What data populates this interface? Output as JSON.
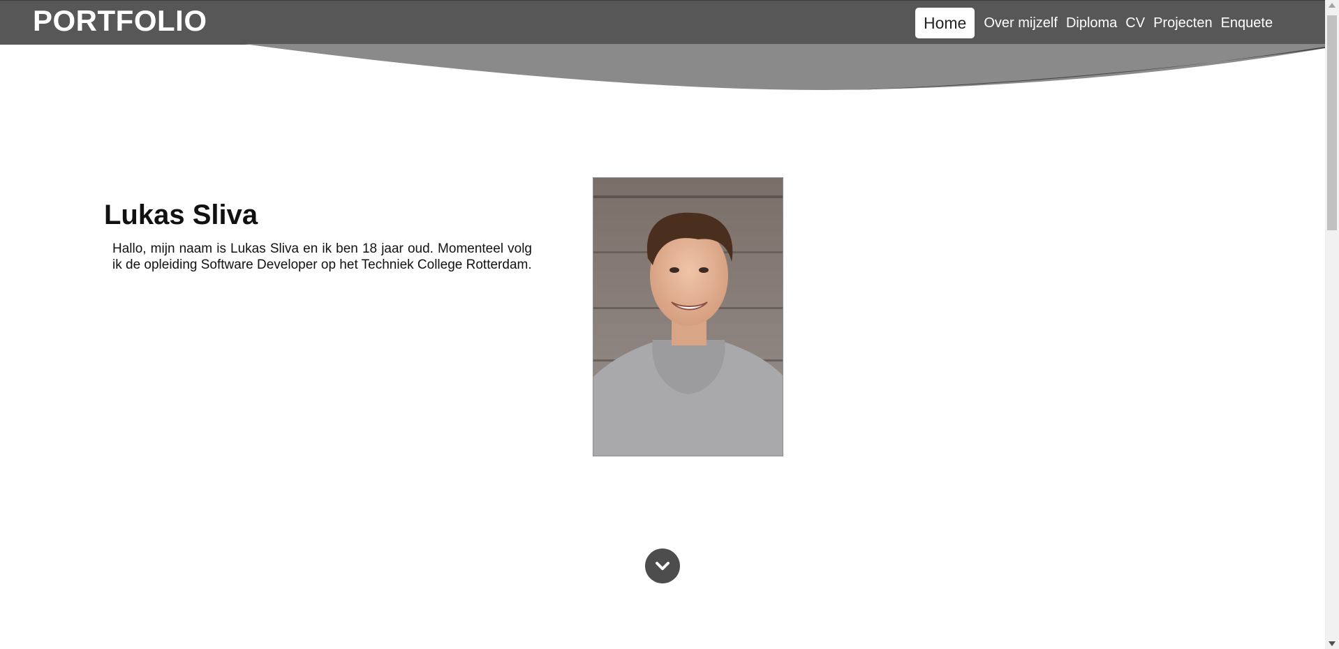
{
  "header": {
    "brand": "PORTFOLIO",
    "nav": [
      {
        "label": "Home",
        "active": true
      },
      {
        "label": "Over mijzelf",
        "active": false
      },
      {
        "label": "Diploma",
        "active": false
      },
      {
        "label": "CV",
        "active": false
      },
      {
        "label": "Projecten",
        "active": false
      },
      {
        "label": "Enquete",
        "active": false
      }
    ]
  },
  "main": {
    "name": "Lukas Sliva",
    "intro": "Hallo, mijn naam is Lukas Sliva en ik ben 18 jaar oud. Momenteel volg ik de opleiding Software Developer op het Techniek College Rotterdam.",
    "photo_icon": "portrait-photo",
    "scroll_button_icon": "chevron-down-icon"
  },
  "colors": {
    "header_bg": "#575757",
    "wave_light": "#8a8a8a",
    "wave_mid": "#767676",
    "wave_dark": "#444444",
    "active_nav_bg": "#ffffff",
    "scroll_button_bg": "#4d4d4d"
  }
}
